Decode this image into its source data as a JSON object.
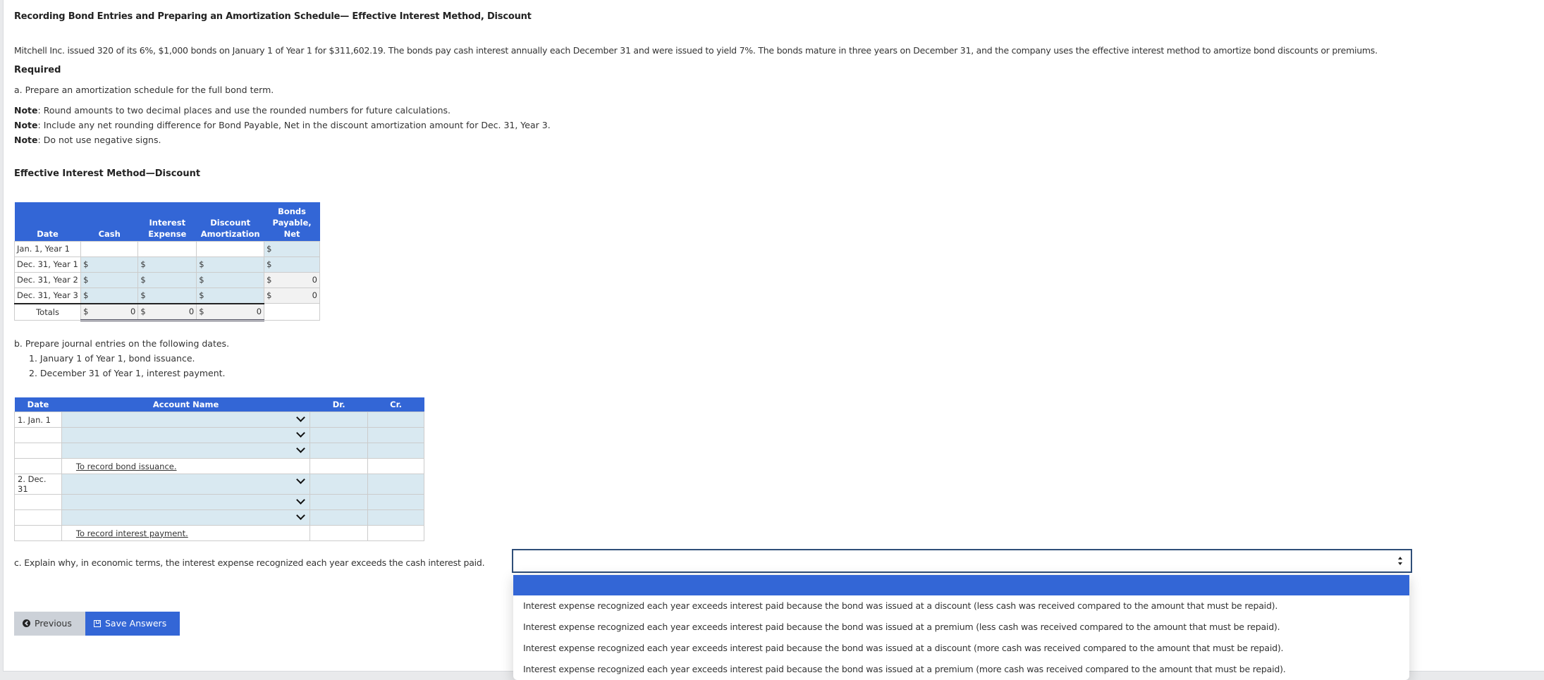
{
  "title": "Recording Bond Entries and Preparing an Amortization Schedule— Effective Interest Method, Discount",
  "intro": "Mitchell Inc. issued 320 of its 6%, $1,000 bonds on January 1 of Year 1 for $311,602.19. The bonds pay cash interest annually each December 31 and were issued to yield 7%. The bonds mature in three years on December 31, and the company uses the effective interest method to amortize bond discounts or premiums.",
  "required_label": "Required",
  "part_a": {
    "text": "a. Prepare an amortization schedule for the full bond term.",
    "notes": [
      {
        "label": "Note",
        "text": ": Round amounts to two decimal places and use the rounded numbers for future calculations."
      },
      {
        "label": "Note",
        "text": ": Include any net rounding difference for Bond Payable, Net in the discount amortization amount for Dec. 31, Year 3."
      },
      {
        "label": "Note",
        "text": ": Do not use negative signs."
      }
    ]
  },
  "schedule": {
    "heading": "Effective Interest Method—Discount",
    "columns": [
      "Date",
      "Cash",
      "Interest Expense",
      "Discount Amortization",
      "Bonds Payable, Net"
    ],
    "currency": "$",
    "rows": [
      {
        "date": "Jan. 1, Year 1",
        "cash": null,
        "interest": null,
        "discount": null,
        "bonds": ""
      },
      {
        "date": "Dec. 31, Year 1",
        "cash": "",
        "interest": "",
        "discount": "",
        "bonds": ""
      },
      {
        "date": "Dec. 31, Year 2",
        "cash": "",
        "interest": "",
        "discount": "",
        "bonds": "0"
      },
      {
        "date": "Dec. 31, Year 3",
        "cash": "",
        "interest": "",
        "discount": "",
        "bonds": "0"
      }
    ],
    "totals": {
      "label": "Totals",
      "cash": "0",
      "interest": "0",
      "discount": "0"
    }
  },
  "part_b": {
    "text": "b. Prepare journal entries on the following dates.",
    "items": [
      "1. January 1 of Year 1, bond issuance.",
      "2. December 31 of Year 1, interest payment."
    ]
  },
  "journal": {
    "columns": [
      "Date",
      "Account Name",
      "Dr.",
      "Cr."
    ],
    "entries": [
      {
        "date": "1. Jan. 1",
        "memo": "To record bond issuance."
      },
      {
        "date": "2. Dec. 31",
        "memo": "To record interest payment."
      }
    ]
  },
  "part_c": {
    "text": "c. Explain why, in economic terms, the interest expense recognized each year exceeds the cash interest paid.",
    "selected_value": "",
    "options": [
      "",
      "Interest expense recognized each year exceeds interest paid because the bond was issued at a discount (less cash was received compared to the amount that must be repaid).",
      "Interest expense recognized each year exceeds interest paid because the bond was issued at a premium (less cash was received compared to the amount that must be repaid).",
      "Interest expense recognized each year exceeds interest paid because the bond was issued at a discount (more cash was received compared to the amount that must be repaid).",
      "Interest expense recognized each year exceeds interest paid because the bond was issued at a premium (more cash was received compared to the amount that must be repaid)."
    ]
  },
  "buttons": {
    "previous": "Previous",
    "save": "Save Answers"
  },
  "colors": {
    "accent": "#3366d6",
    "input_fill": "#d9e9f1",
    "readonly_fill": "#f2f2f2",
    "page_bg": "#e9eaec"
  }
}
